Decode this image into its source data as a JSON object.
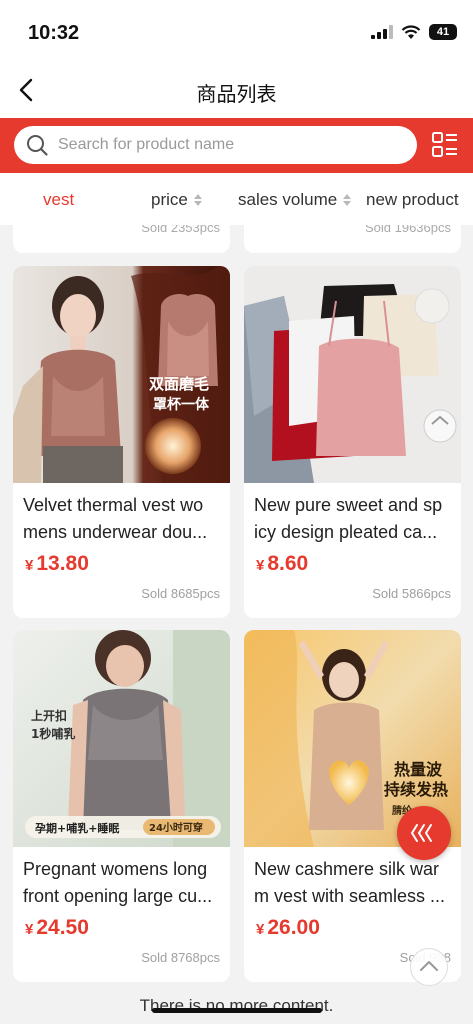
{
  "status_bar": {
    "time": "10:32",
    "battery": "41"
  },
  "nav": {
    "title": "商品列表"
  },
  "search": {
    "placeholder": "Search for product name"
  },
  "sort_tabs": [
    {
      "label": "vest",
      "active": true
    },
    {
      "label": "price"
    },
    {
      "label": "sales volume"
    },
    {
      "label": "new product"
    }
  ],
  "partial_row": [
    {
      "sold": "Sold 2353pcs"
    },
    {
      "sold": "Sold 19636pcs"
    }
  ],
  "products": [
    {
      "title_line1": "Velvet thermal vest wo",
      "title_line2": "mens underwear dou...",
      "currency": "¥",
      "price": "13.80",
      "sold": "Sold 8685pcs",
      "image_text_1": "双面磨毛",
      "image_text_2": "罩杯一体"
    },
    {
      "title_line1": "New pure sweet and sp",
      "title_line2": "icy design pleated ca...",
      "currency": "¥",
      "price": "8.60",
      "sold": "Sold 5866pcs"
    },
    {
      "title_line1": "Pregnant womens long",
      "title_line2": "front opening large cu...",
      "currency": "¥",
      "price": "24.50",
      "sold": "Sold 8768pcs",
      "image_text_1": "上开扣",
      "image_text_2": "1秒哺乳",
      "image_text_3": "孕期+哺乳+睡眠",
      "image_text_4": "24小时可穿"
    },
    {
      "title_line1": "New cashmere silk war",
      "title_line2": "m vest with seamless ...",
      "currency": "¥",
      "price": "26.00",
      "sold": "Sold 988",
      "image_text_1": "热量波",
      "image_text_2": "持续发热",
      "image_text_3": "腈纶+°C"
    }
  ],
  "footer": {
    "no_more": "There is no more content."
  },
  "colors": {
    "accent": "#e53a2d",
    "background": "#f2f2f2"
  },
  "icons": [
    "back-icon",
    "search-icon",
    "grid-toggle-icon",
    "sort-arrows-icon",
    "scroll-top-icon",
    "chevron-up-icon"
  ]
}
